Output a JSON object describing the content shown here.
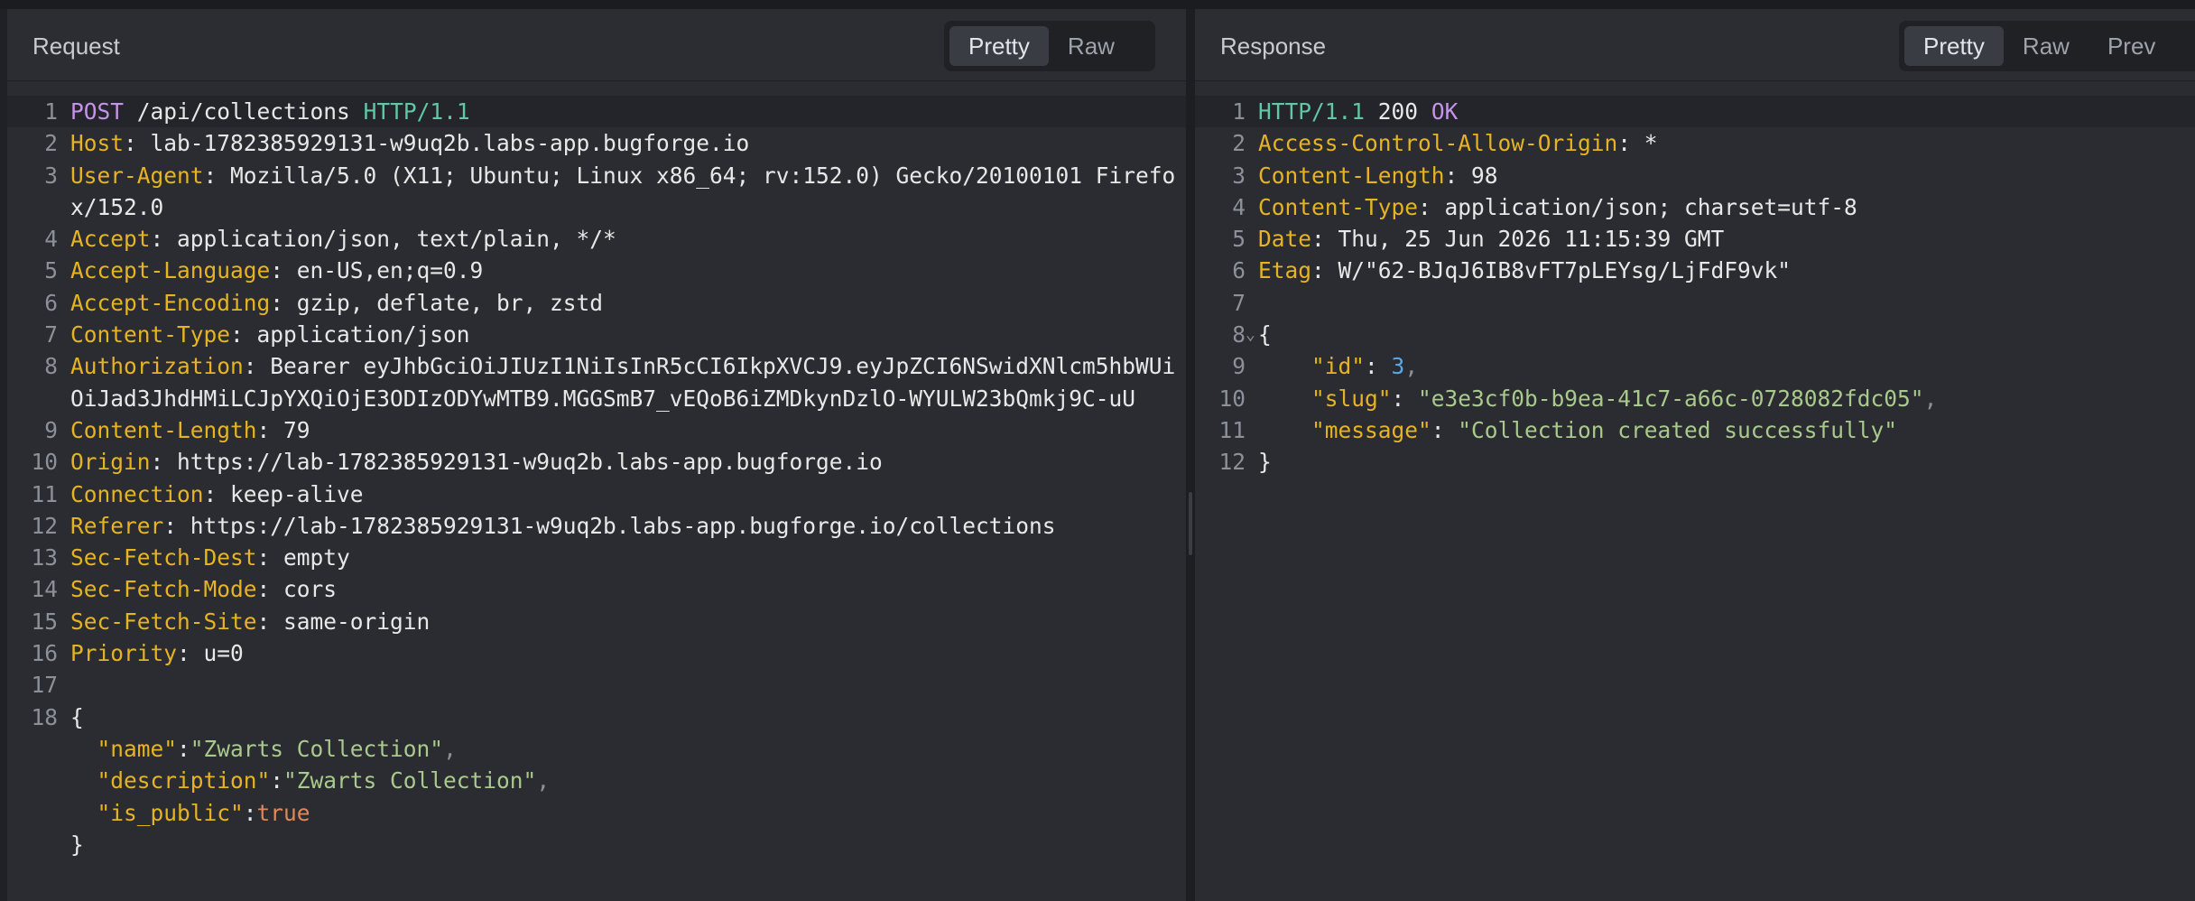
{
  "request": {
    "title": "Request",
    "view_tabs": [
      "Pretty",
      "Raw"
    ],
    "active_tab": "Pretty",
    "request_line": {
      "method": "POST",
      "path": "/api/collections",
      "protocol": "HTTP/1.1"
    },
    "headers": [
      {
        "name": "Host",
        "value": "lab-1782385929131-w9uq2b.labs-app.bugforge.io"
      },
      {
        "name": "User-Agent",
        "value": "Mozilla/5.0 (X11; Ubuntu; Linux x86_64; rv:152.0) Gecko/20100101 Firefox/152.0"
      },
      {
        "name": "Accept",
        "value": "application/json, text/plain, */*"
      },
      {
        "name": "Accept-Language",
        "value": "en-US,en;q=0.9"
      },
      {
        "name": "Accept-Encoding",
        "value": "gzip, deflate, br, zstd"
      },
      {
        "name": "Content-Type",
        "value": "application/json"
      },
      {
        "name": "Authorization",
        "value": "Bearer eyJhbGciOiJIUzI1NiIsInR5cCI6IkpXVCJ9.eyJpZCI6NSwidXNlcm5hbWUiOiJad3JhdHMiLCJpYXQiOjE3ODIzODYwMTB9.MGGSmB7_vEQoB6iZMDkynDzlO-WYULW23bQmkj9C-uU"
      },
      {
        "name": "Content-Length",
        "value": "79"
      },
      {
        "name": "Origin",
        "value": "https://lab-1782385929131-w9uq2b.labs-app.bugforge.io"
      },
      {
        "name": "Connection",
        "value": "keep-alive"
      },
      {
        "name": "Referer",
        "value": "https://lab-1782385929131-w9uq2b.labs-app.bugforge.io/collections"
      },
      {
        "name": "Sec-Fetch-Dest",
        "value": "empty"
      },
      {
        "name": "Sec-Fetch-Mode",
        "value": "cors"
      },
      {
        "name": "Sec-Fetch-Site",
        "value": "same-origin"
      },
      {
        "name": "Priority",
        "value": "u=0"
      }
    ],
    "body_open": "{",
    "body_fields": [
      {
        "key": "\"name\"",
        "value": "\"Zwarts Collection\"",
        "type": "string",
        "comma": true
      },
      {
        "key": "\"description\"",
        "value": "\"Zwarts Collection\"",
        "type": "string",
        "comma": true
      },
      {
        "key": "\"is_public\"",
        "value": "true",
        "type": "bool",
        "comma": false
      }
    ],
    "body_close": "}"
  },
  "response": {
    "title": "Response",
    "view_tabs": [
      "Pretty",
      "Raw",
      "Prev"
    ],
    "active_tab": "Pretty",
    "status_line": {
      "protocol": "HTTP/1.1",
      "code": "200",
      "reason": "OK"
    },
    "headers": [
      {
        "name": "Access-Control-Allow-Origin",
        "value": "*"
      },
      {
        "name": "Content-Length",
        "value": "98"
      },
      {
        "name": "Content-Type",
        "value": "application/json; charset=utf-8"
      },
      {
        "name": "Date",
        "value": "Thu, 25 Jun 2026 11:15:39 GMT"
      },
      {
        "name": "Etag",
        "value": "W/\"62-BJqJ6IB8vFT7pLEYsg/LjFdF9vk\""
      }
    ],
    "body_open": "{",
    "body_fields": [
      {
        "key": "\"id\"",
        "value": "3",
        "type": "number",
        "comma": true
      },
      {
        "key": "\"slug\"",
        "value": "\"e3e3cf0b-b9ea-41c7-a66c-0728082fdc05\"",
        "type": "string",
        "comma": true
      },
      {
        "key": "\"message\"",
        "value": "\"Collection created successfully\"",
        "type": "string",
        "comma": false
      }
    ],
    "body_close": "}",
    "fold_icon": "chevron-down-icon"
  },
  "colors": {
    "method": "#c792ea",
    "protocol": "#5fc8a4",
    "header_name": "#e6b422",
    "string": "#a9c98d",
    "number": "#5aa7e6",
    "boolean": "#e0885a",
    "pane_bg": "#2a2c31"
  }
}
